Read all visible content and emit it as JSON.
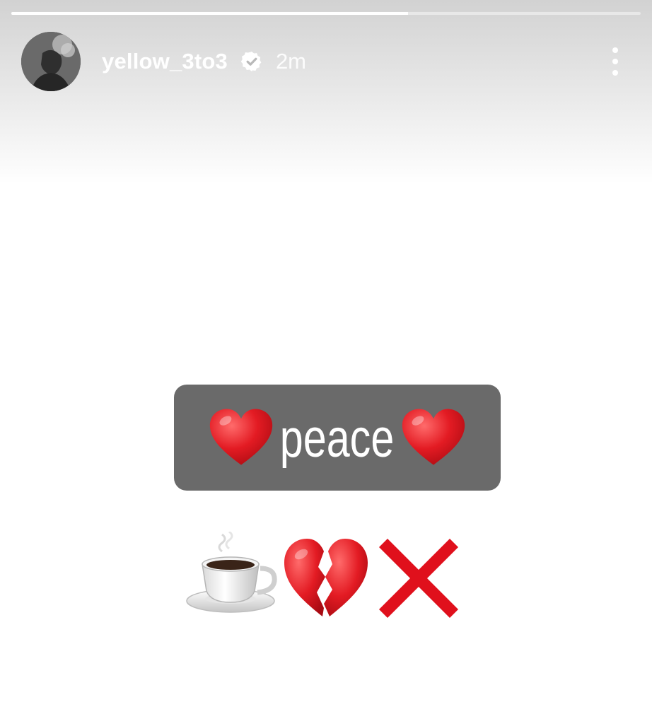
{
  "story": {
    "progress": 0.63,
    "username": "yellow_3to3",
    "verified": true,
    "time_ago": "2m",
    "sticker_text": "peace",
    "sticker_emojis": [
      "red-heart",
      "red-heart"
    ],
    "emoji_line": [
      "hot-beverage",
      "broken-heart",
      "cross-mark"
    ]
  },
  "icons": {
    "verified": "verified-badge-icon",
    "more": "more-options-icon"
  },
  "colors": {
    "sticker_bg": "#6a6a6a",
    "heart_red": "#e31b23",
    "cross_red": "#e0101c"
  }
}
